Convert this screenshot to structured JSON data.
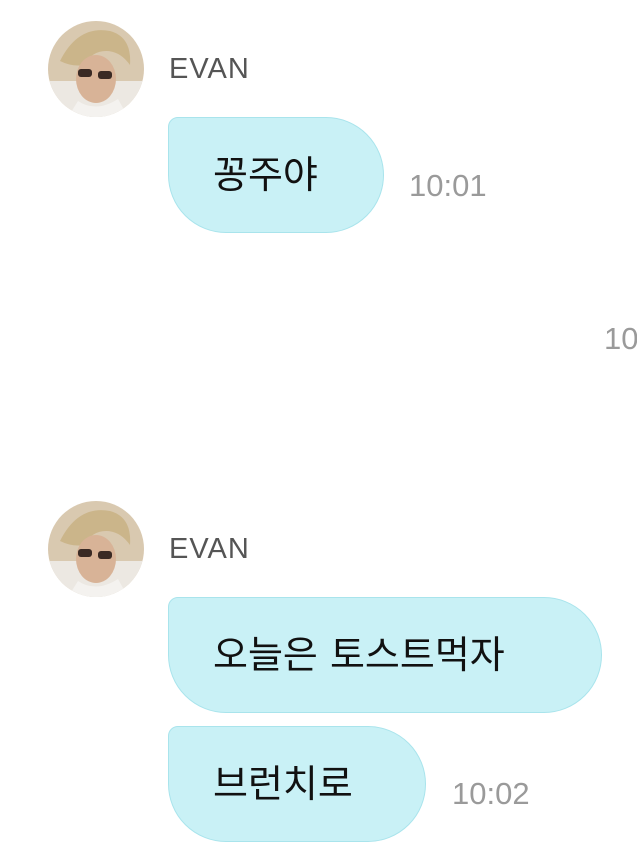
{
  "messages": [
    {
      "sender": "EVAN",
      "avatar_icon": "profile-photo",
      "bubbles": [
        {
          "text": "꽁주야",
          "time": "10:01"
        }
      ]
    },
    {
      "sender": "EVAN",
      "avatar_icon": "profile-photo",
      "bubbles": [
        {
          "text": "오늘은 토스트먹자",
          "time": ""
        },
        {
          "text": "브런치로",
          "time": "10:02"
        }
      ]
    }
  ],
  "outgoing_time_partial": "10",
  "colors": {
    "bubble_bg": "#c9f1f6",
    "bubble_border": "#a9e4ec",
    "timestamp": "#9a9a9a",
    "sender": "#555555"
  }
}
